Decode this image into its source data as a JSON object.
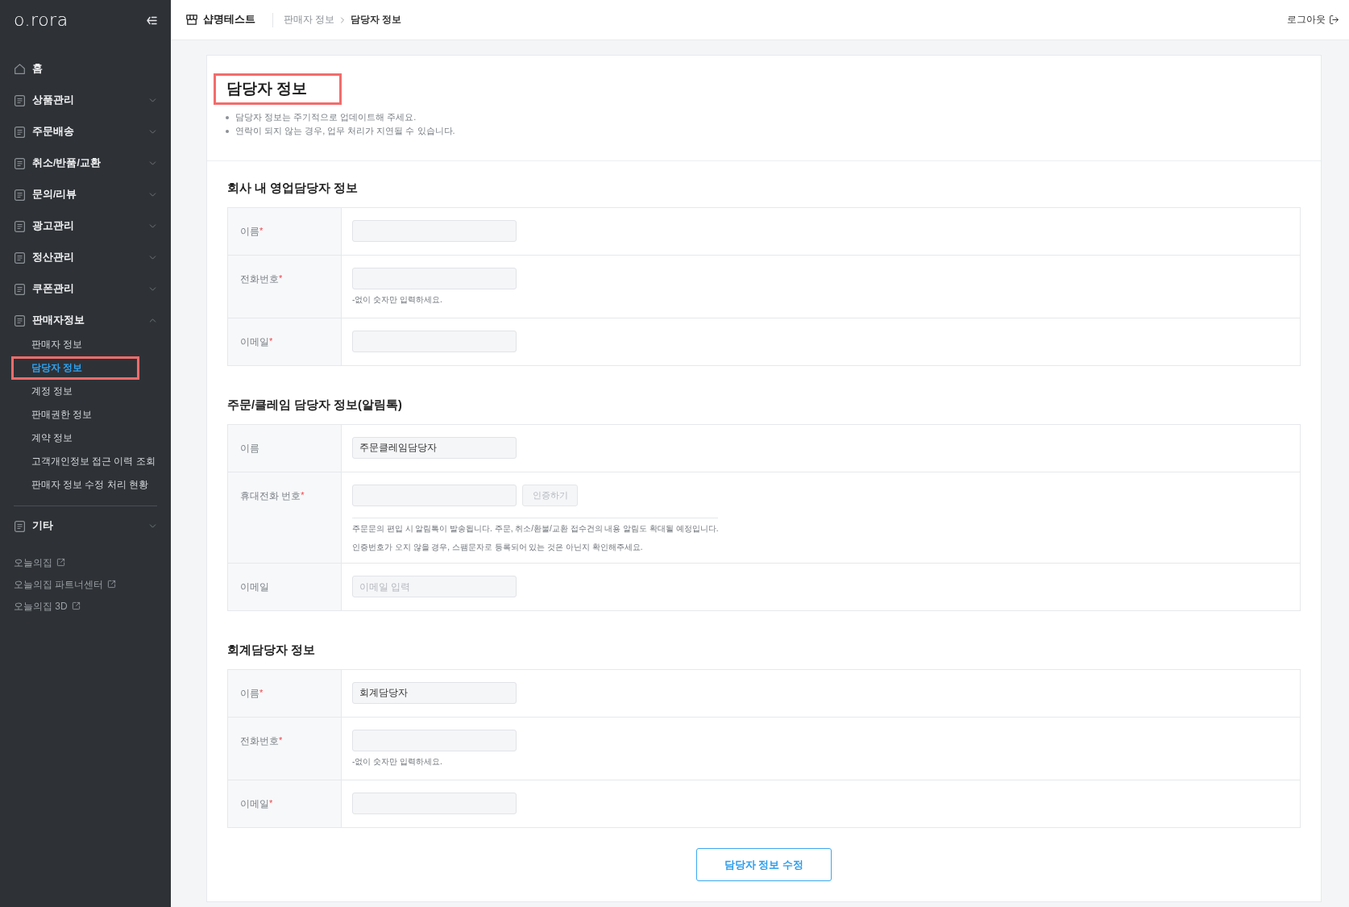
{
  "sidebar": {
    "logo": "o.rora",
    "menu": [
      {
        "kind": "home",
        "label": "홈"
      },
      {
        "kind": "group",
        "label": "상품관리",
        "expanded": false
      },
      {
        "kind": "group",
        "label": "주문배송",
        "expanded": false
      },
      {
        "kind": "group",
        "label": "취소/반품/교환",
        "expanded": false
      },
      {
        "kind": "group",
        "label": "문의/리뷰",
        "expanded": false
      },
      {
        "kind": "group",
        "label": "광고관리",
        "expanded": false
      },
      {
        "kind": "group",
        "label": "정산관리",
        "expanded": false
      },
      {
        "kind": "group",
        "label": "쿠폰관리",
        "expanded": false
      },
      {
        "kind": "group",
        "label": "판매자정보",
        "expanded": true,
        "children": [
          {
            "label": "판매자 정보",
            "selected": false,
            "highlighted": false
          },
          {
            "label": "담당자 정보",
            "selected": true,
            "highlighted": true
          },
          {
            "label": "계정 정보",
            "selected": false,
            "highlighted": false
          },
          {
            "label": "판매권한 정보",
            "selected": false,
            "highlighted": false
          },
          {
            "label": "계약 정보",
            "selected": false,
            "highlighted": false
          },
          {
            "label": "고객개인정보 접근 이력 조회",
            "selected": false,
            "highlighted": false
          },
          {
            "label": "판매자 정보 수정 처리 현황",
            "selected": false,
            "highlighted": false
          }
        ]
      }
    ],
    "extra_menu": [
      {
        "kind": "group",
        "label": "기타",
        "expanded": false
      }
    ],
    "links": [
      {
        "label": "오늘의집"
      },
      {
        "label": "오늘의집 파트너센터"
      },
      {
        "label": "오늘의집 3D"
      }
    ]
  },
  "header": {
    "shop_name": "샵명테스트",
    "breadcrumb": [
      {
        "label": "판매자 정보",
        "current": false
      },
      {
        "label": "담당자 정보",
        "current": true
      }
    ],
    "logout": "로그아웃"
  },
  "page": {
    "title": "담당자 정보",
    "title_highlighted": true,
    "notices": [
      "담당자 정보는 주기적으로 업데이트해 주세요.",
      "연락이 되지 않는 경우, 업무 처리가 지연될 수 있습니다."
    ],
    "required_mark": "*",
    "sections": [
      {
        "title": "회사 내 영업담당자 정보",
        "fields": [
          {
            "kind": "input",
            "label": "이름",
            "required": true
          },
          {
            "kind": "input",
            "label": "전화번호",
            "required": true,
            "hint": "-없이 숫자만 입력하세요."
          },
          {
            "kind": "input",
            "label": "이메일",
            "required": true
          }
        ]
      },
      {
        "title": "주문/클레임 담당자 정보(알림톡)",
        "fields": [
          {
            "kind": "input",
            "label": "이름",
            "required": false,
            "value": "주문클레임담당자"
          },
          {
            "kind": "verify",
            "label": "휴대전화 번호",
            "required": true,
            "action": {
              "label": "인증하기",
              "disabled": true
            },
            "notes": [
              "주문문의 편입 시 알림톡이 발송됩니다. 주문, 취소/환불/교환 접수건의 내용 알림도 확대될 예정입니다.",
              "인증번호가 오지 않을 경우, 스팸문자로 등록되어 있는 것은 아닌지 확인해주세요."
            ]
          },
          {
            "kind": "input",
            "label": "이메일",
            "required": false,
            "placeholder": "이메일 입력"
          }
        ]
      },
      {
        "title": "회계담당자 정보",
        "fields": [
          {
            "kind": "input",
            "label": "이름",
            "required": true,
            "value": "회계담당자"
          },
          {
            "kind": "input",
            "label": "전화번호",
            "required": true,
            "hint": "-없이 숫자만 입력하세요."
          },
          {
            "kind": "input",
            "label": "이메일",
            "required": true
          }
        ]
      }
    ],
    "submit_button": "담당자 정보 수정"
  }
}
